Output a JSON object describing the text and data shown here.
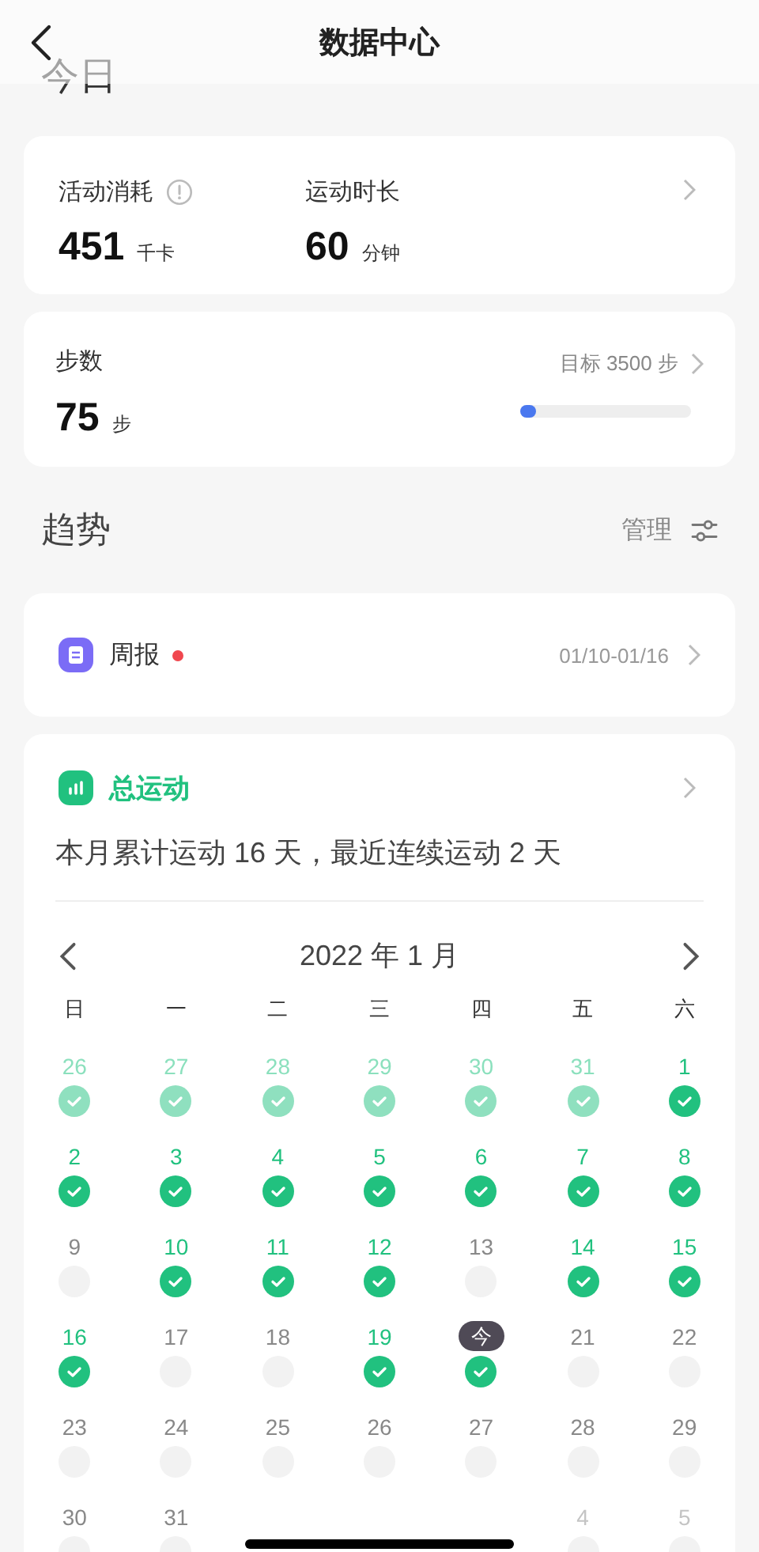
{
  "header": {
    "title": "数据中心"
  },
  "today_section": {
    "title": "今日"
  },
  "activity_card": {
    "metrics": [
      {
        "label": "活动消耗",
        "value": "451",
        "unit": "千卡",
        "kind": "info"
      },
      {
        "label": "运动时长",
        "value": "60",
        "unit": "分钟",
        "kind": "plain"
      }
    ]
  },
  "steps_card": {
    "label": "步数",
    "value": "75",
    "unit": "步",
    "goal": "目标 3500 步",
    "level": 0.02
  },
  "trend_section": {
    "title": "趋势",
    "manage": "管理"
  },
  "weekly_report": {
    "title": "周报",
    "unread": true,
    "range": "01/10-01/16"
  },
  "total_exercise": {
    "title": "总运动",
    "summary": "本月累计运动 16 天，最近连续运动 2 天",
    "month": "2022 年 1 月",
    "weekdays": [
      "日",
      "一",
      "二",
      "三",
      "四",
      "五",
      "六"
    ],
    "days": [
      {
        "label": "26",
        "outside": true,
        "done": true
      },
      {
        "label": "27",
        "outside": true,
        "done": true
      },
      {
        "label": "28",
        "outside": true,
        "done": true
      },
      {
        "label": "29",
        "outside": true,
        "done": true
      },
      {
        "label": "30",
        "outside": true,
        "done": true
      },
      {
        "label": "31",
        "outside": true,
        "done": true
      },
      {
        "label": "1",
        "outside": false,
        "done": true
      },
      {
        "label": "2",
        "outside": false,
        "done": true
      },
      {
        "label": "3",
        "outside": false,
        "done": true
      },
      {
        "label": "4",
        "outside": false,
        "done": true
      },
      {
        "label": "5",
        "outside": false,
        "done": true
      },
      {
        "label": "6",
        "outside": false,
        "done": true
      },
      {
        "label": "7",
        "outside": false,
        "done": true
      },
      {
        "label": "8",
        "outside": false,
        "done": true
      },
      {
        "label": "9",
        "outside": false,
        "done": false
      },
      {
        "label": "10",
        "outside": false,
        "done": true
      },
      {
        "label": "11",
        "outside": false,
        "done": true
      },
      {
        "label": "12",
        "outside": false,
        "done": true
      },
      {
        "label": "13",
        "outside": false,
        "done": false
      },
      {
        "label": "14",
        "outside": false,
        "done": true
      },
      {
        "label": "15",
        "outside": false,
        "done": true
      },
      {
        "label": "16",
        "outside": false,
        "done": true
      },
      {
        "label": "17",
        "outside": false,
        "done": false
      },
      {
        "label": "18",
        "outside": false,
        "done": false
      },
      {
        "label": "19",
        "outside": false,
        "done": true
      },
      {
        "label": "今",
        "outside": false,
        "done": true,
        "today": true
      },
      {
        "label": "21",
        "outside": false,
        "done": false
      },
      {
        "label": "22",
        "outside": false,
        "done": false
      },
      {
        "label": "23",
        "outside": false,
        "done": false
      },
      {
        "label": "24",
        "outside": false,
        "done": false
      },
      {
        "label": "25",
        "outside": false,
        "done": false
      },
      {
        "label": "26",
        "outside": false,
        "done": false
      },
      {
        "label": "27",
        "outside": false,
        "done": false
      },
      {
        "label": "28",
        "outside": false,
        "done": false
      },
      {
        "label": "29",
        "outside": false,
        "done": false
      },
      {
        "label": "30",
        "outside": false,
        "done": false
      },
      {
        "label": "31",
        "outside": false,
        "done": false
      },
      {
        "kind": "covered"
      },
      {
        "kind": "covered"
      },
      {
        "kind": "covered"
      },
      {
        "label": "4",
        "outside": true,
        "done": false
      },
      {
        "label": "5",
        "outside": true,
        "done": false
      }
    ]
  }
}
